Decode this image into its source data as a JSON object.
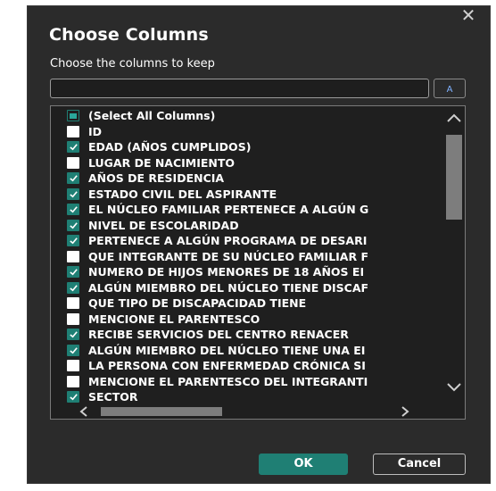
{
  "dialog": {
    "title": "Choose Columns",
    "subtitle": "Choose the columns to keep",
    "close_glyph": "✕",
    "search": {
      "value": "",
      "placeholder": ""
    },
    "sort_icon": "sort-az-icon"
  },
  "columns": [
    {
      "label": "(Select All Columns)",
      "state": "partial"
    },
    {
      "label": "ID",
      "state": "off"
    },
    {
      "label": "EDAD (AÑOS CUMPLIDOS)",
      "state": "on"
    },
    {
      "label": "LUGAR DE NACIMIENTO",
      "state": "off"
    },
    {
      "label": "AÑOS DE RESIDENCIA",
      "state": "on"
    },
    {
      "label": "ESTADO CIVIL DEL ASPIRANTE",
      "state": "on"
    },
    {
      "label": "EL NÚCLEO FAMILIAR PERTENECE A ALGÚN G",
      "state": "on"
    },
    {
      "label": "NIVEL DE ESCOLARIDAD",
      "state": "on"
    },
    {
      "label": "PERTENECE A ALGÚN PROGRAMA DE DESARI",
      "state": "on"
    },
    {
      "label": "QUE INTEGRANTE DE SU NÚCLEO FAMILIAR F",
      "state": "off"
    },
    {
      "label": "NUMERO DE HIJOS MENORES DE 18 AÑOS EI",
      "state": "on"
    },
    {
      "label": "ALGÚN MIEMBRO DEL NÚCLEO TIENE DISCAF",
      "state": "on"
    },
    {
      "label": "QUE TIPO DE DISCAPACIDAD TIENE",
      "state": "off"
    },
    {
      "label": "MENCIONE EL PARENTESCO",
      "state": "off"
    },
    {
      "label": "RECIBE SERVICIOS DEL CENTRO RENACER",
      "state": "on"
    },
    {
      "label": "ALGÚN MIEMBRO DEL NÚCLEO TIENE UNA EI",
      "state": "on"
    },
    {
      "label": "LA PERSONA CON ENFERMEDAD CRÓNICA SI",
      "state": "off"
    },
    {
      "label": "MENCIONE EL PARENTESCO DEL INTEGRANTI",
      "state": "off"
    },
    {
      "label": "SECTOR",
      "state": "on"
    }
  ],
  "buttons": {
    "ok": "OK",
    "cancel": "Cancel"
  },
  "colors": {
    "accent": "#1f7f74",
    "dialog_bg": "#2b2b2b",
    "list_bg": "#1f1f1f"
  }
}
